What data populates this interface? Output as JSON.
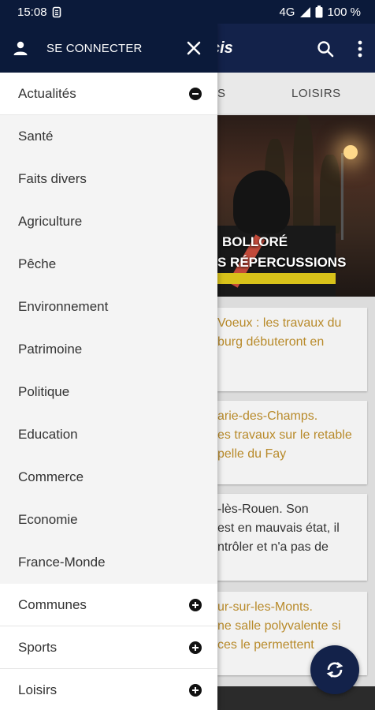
{
  "status_bar": {
    "time": "15:08",
    "network": "4G",
    "battery": "100 %"
  },
  "app": {
    "brand": "cis",
    "tabs": [
      "S",
      "LOISIRS"
    ],
    "hero_title": [
      "BOLLORÉ",
      "S RÉPERCUSSIONS"
    ],
    "cards": [
      {
        "lines": "Voeux : les travaux du\nburg débuteront en"
      },
      {
        "lines": "arie-des-Champs.\nes travaux sur le retable\npelle du Fay"
      },
      {
        "lines": "-lès-Rouen. Son\nest en mauvais état, il\nntrôler et n'a pas de"
      },
      {
        "lines": "ur-sur-les-Monts.\nne salle polyvalente si\nces le permettent"
      }
    ]
  },
  "drawer": {
    "login_label": "SE CONNECTER",
    "sections": [
      {
        "label": "Actualités",
        "state": "expanded"
      },
      {
        "label": "Communes",
        "state": "collapsed"
      },
      {
        "label": "Sports",
        "state": "collapsed"
      },
      {
        "label": "Loisirs",
        "state": "collapsed"
      }
    ],
    "sub_items": [
      "Santé",
      "Faits divers",
      "Agriculture",
      "Pêche",
      "Environnement",
      "Patrimoine",
      "Politique",
      "Education",
      "Commerce",
      "Economie",
      "France-Monde"
    ]
  },
  "colors": {
    "header": "#13224a",
    "drawer_header": "#0b1a3a",
    "accent_text": "#b88a2a"
  },
  "icons": {
    "login": "person-icon",
    "close": "close-icon",
    "search": "search-icon",
    "more": "more-vert-icon",
    "refresh": "refresh-icon"
  }
}
